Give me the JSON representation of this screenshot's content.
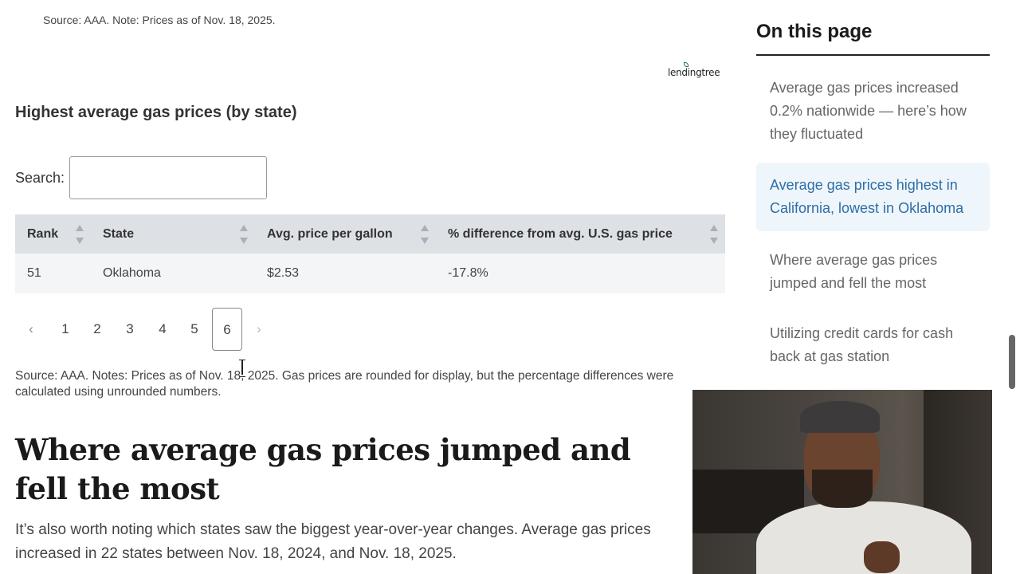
{
  "top_source": "Source: AAA. Note: Prices as of Nov. 18, 2025.",
  "logo_text": "lendingtree",
  "table": {
    "title": "Highest average gas prices (by state)",
    "search_label": "Search:",
    "search_value": "",
    "headers": [
      "Rank",
      "State",
      "Avg. price per gallon",
      "% difference from avg. U.S. gas price"
    ],
    "rows": [
      [
        "51",
        "Oklahoma",
        "$2.53",
        "-17.8%"
      ]
    ]
  },
  "pagination": {
    "prev": "‹",
    "pages": [
      "1",
      "2",
      "3",
      "4",
      "5",
      "6"
    ],
    "current": "6",
    "next": "›"
  },
  "notes": "Source: AAA. Notes: Prices as of Nov. 18, 2025. Gas prices are rounded for display, but the percentage differences were calculated using unrounded numbers.",
  "section_heading": "Where average gas prices jumped and fell the most",
  "section_paragraph": "It’s also worth noting which states saw the biggest year-over-year changes. Average gas prices increased in 22 states between Nov. 18, 2024, and Nov. 18, 2025.",
  "toc": {
    "title": "On this page",
    "items": [
      {
        "label": "Average gas prices increased 0.2% nationwide — here’s how they fluctuated",
        "active": false
      },
      {
        "label": "Average gas prices highest in California, lowest in Oklahoma",
        "active": true
      },
      {
        "label": "Where average gas prices jumped and fell the most",
        "active": false
      },
      {
        "label": "Utilizing credit cards for cash back at gas station",
        "active": false
      }
    ]
  },
  "colors": {
    "header_bg": "#dde1e5",
    "row_bg": "#f4f5f6",
    "toc_active_bg": "#eef5fb",
    "toc_active_text": "#2e6ea6"
  }
}
